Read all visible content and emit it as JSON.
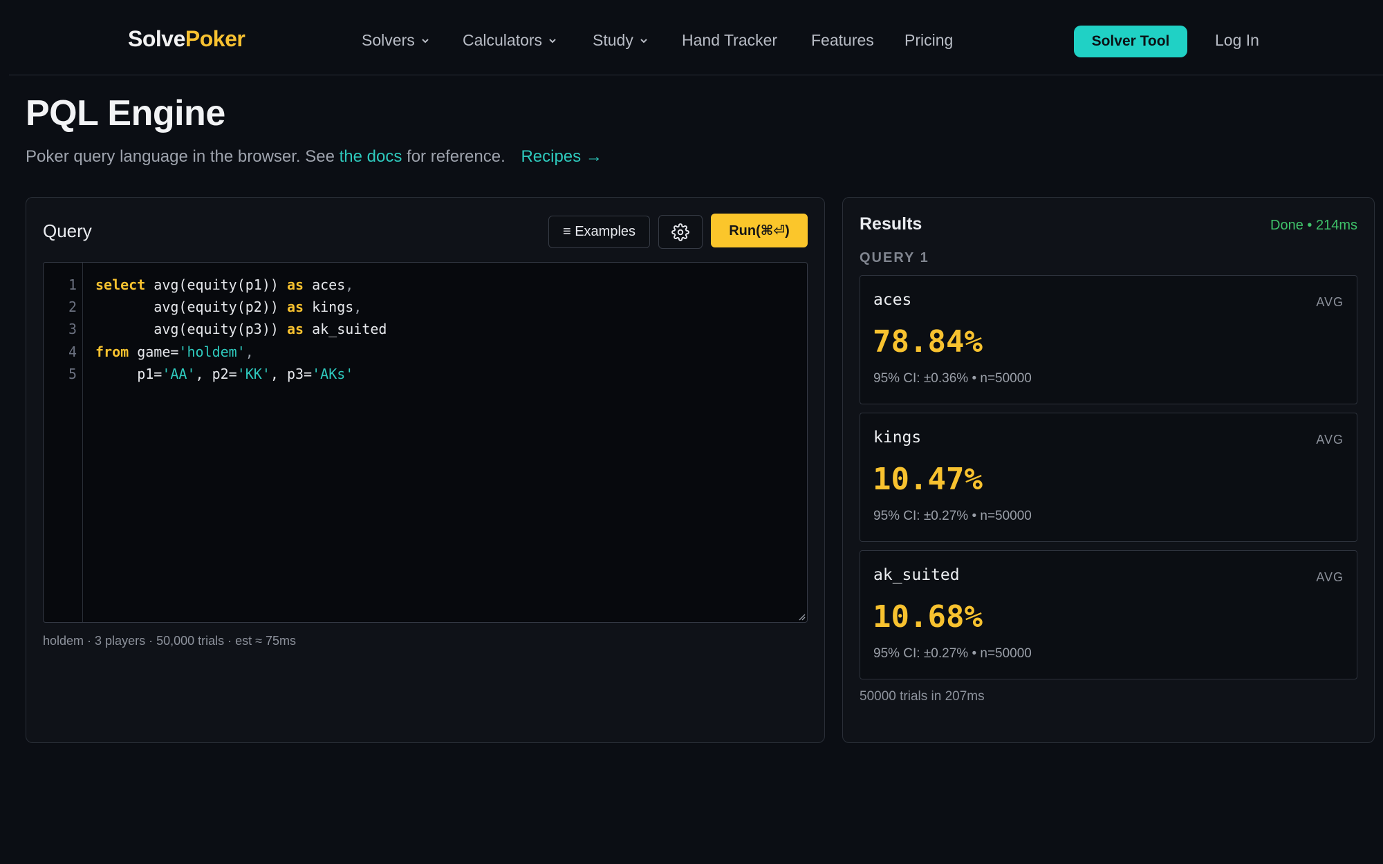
{
  "brand": {
    "part1": "Solve",
    "part2": "Poker"
  },
  "nav": {
    "solvers": "Solvers",
    "calculators": "Calculators",
    "study": "Study",
    "hand_tracker": "Hand Tracker",
    "features": "Features",
    "pricing": "Pricing",
    "solver_tool": "Solver Tool",
    "login": "Log In"
  },
  "page": {
    "title": "PQL Engine",
    "subtitle_pre": "Poker query language in the browser. See ",
    "docs_link": "the docs",
    "subtitle_post": " for reference.",
    "recipes": "Recipes →"
  },
  "query": {
    "title": "Query",
    "examples_label": "≡ Examples",
    "run_label": "Run(⌘⏎)",
    "line_numbers": [
      "1",
      "2",
      "3",
      "4",
      "5"
    ],
    "code": {
      "l1_kw": "select",
      "l1_rest": " avg(equity(p1)) ",
      "l1_as": "as",
      "l1_alias": " aces",
      "l2_rest": "       avg(equity(p2)) ",
      "l2_as": "as",
      "l2_alias": " kings",
      "l3_rest": "       avg(equity(p3)) ",
      "l3_as": "as",
      "l3_alias": " ak_suited",
      "l4_kw": "from",
      "l4_rest": " game=",
      "l4_str": "'holdem'",
      "l5_p1": "     p1=",
      "l5_s1": "'AA'",
      "l5_p2": ", p2=",
      "l5_s2": "'KK'",
      "l5_p3": ", p3=",
      "l5_s3": "'AKs'"
    },
    "footer": "holdem · 3 players · 50,000 trials · est ≈ 75ms"
  },
  "results": {
    "title": "Results",
    "status": "Done • 214ms",
    "query_label": "QUERY 1",
    "cards": [
      {
        "name": "aces",
        "agg": "AVG",
        "value": "78.84%",
        "ci": "95% CI: ±0.36% • n=50000"
      },
      {
        "name": "kings",
        "agg": "AVG",
        "value": "10.47%",
        "ci": "95% CI: ±0.27% • n=50000"
      },
      {
        "name": "ak_suited",
        "agg": "AVG",
        "value": "10.68%",
        "ci": "95% CI: ±0.27% • n=50000"
      }
    ],
    "footer": "50000 trials in 207ms"
  },
  "colors": {
    "accent_yellow": "#f8c22f",
    "accent_teal": "#20d1c5",
    "status_green": "#3fc26a",
    "background": "#0b0e14"
  },
  "icons": {
    "dropdown": "chevron-down-icon",
    "settings": "gear-icon",
    "resize": "resize-handle-icon"
  }
}
